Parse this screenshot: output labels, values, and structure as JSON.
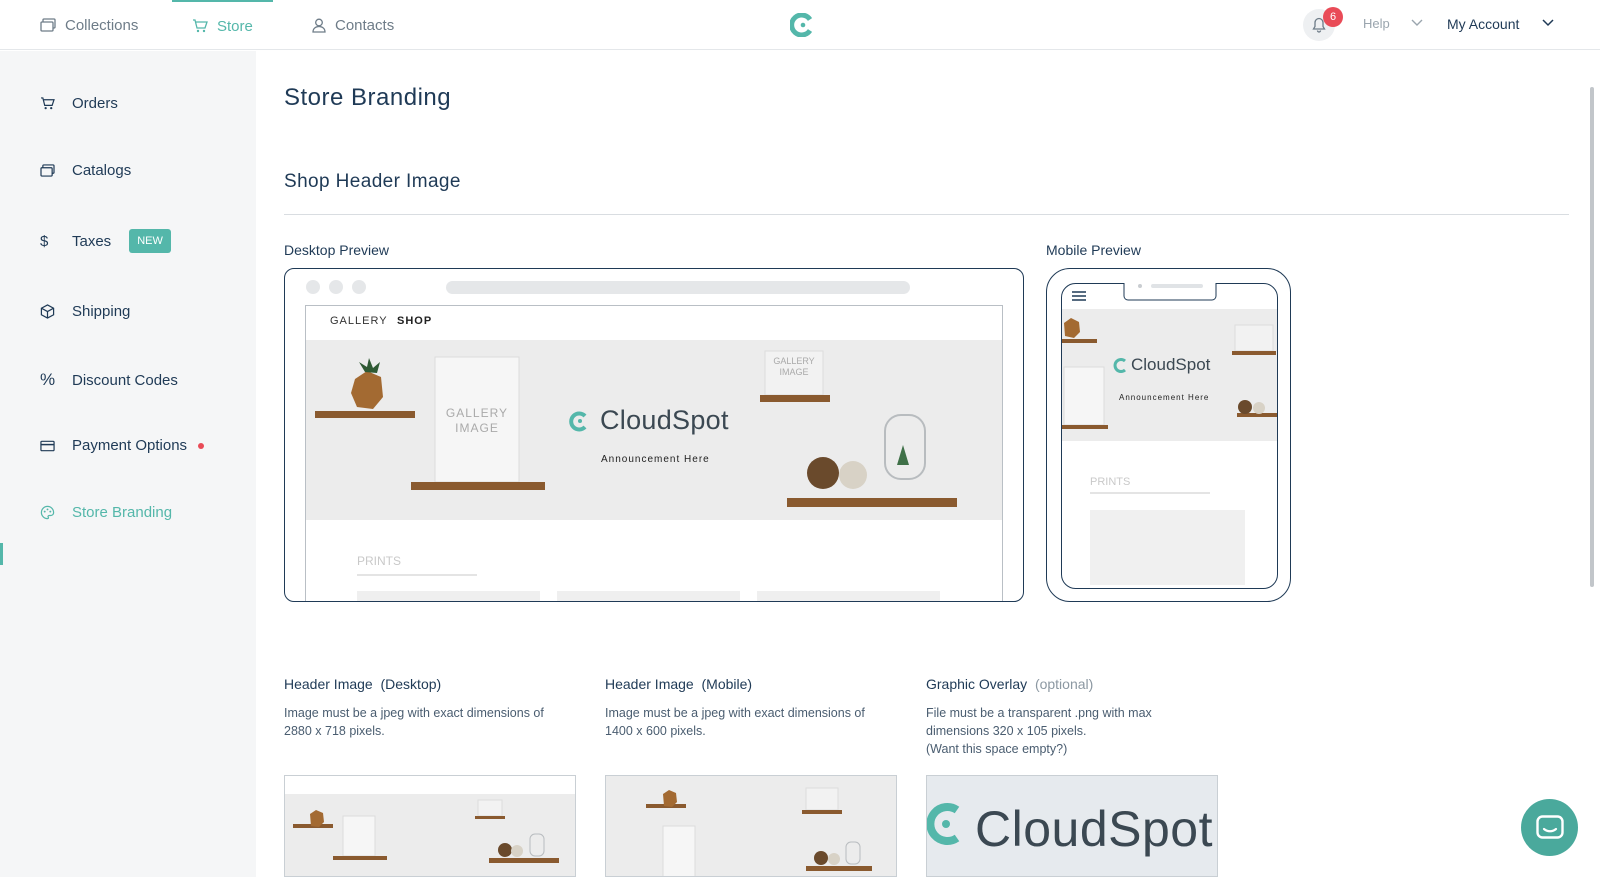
{
  "topnav": {
    "tabs": [
      {
        "label": "Collections",
        "icon": "collections-icon"
      },
      {
        "label": "Store",
        "icon": "cart-icon",
        "active": true
      },
      {
        "label": "Contacts",
        "icon": "person-icon"
      }
    ],
    "notifications_count": "6",
    "help_label": "Help",
    "account_label": "My Account"
  },
  "sidebar": {
    "items": [
      {
        "label": "Orders",
        "icon": "cart-icon"
      },
      {
        "label": "Catalogs",
        "icon": "catalog-icon"
      },
      {
        "label": "Taxes",
        "icon": "dollar-icon",
        "badge": "NEW"
      },
      {
        "label": "Shipping",
        "icon": "box-icon"
      },
      {
        "label": "Discount Codes",
        "icon": "percent-icon"
      },
      {
        "label": "Payment Options",
        "icon": "card-icon",
        "alert": true
      },
      {
        "label": "Store Branding",
        "icon": "palette-icon",
        "active": true
      }
    ]
  },
  "main": {
    "page_title": "Store Branding",
    "section_title": "Shop Header Image",
    "desktop_preview_label": "Desktop Preview",
    "mobile_preview_label": "Mobile Preview",
    "preview": {
      "nav_gallery": "GALLERY",
      "nav_shop": "SHOP",
      "gallery_image_text": "GALLERY\nIMAGE",
      "brand_name": "CloudSpot",
      "announcement": "Announcement Here",
      "prints_label": "PRINTS"
    },
    "uploads": [
      {
        "title": "Header Image",
        "qualifier": "(Desktop)",
        "desc1": "Image must be a jpeg with exact dimensions of",
        "desc2": "2880 x 718 pixels."
      },
      {
        "title": "Header Image",
        "qualifier": "(Mobile)",
        "desc1": "Image must be a jpeg with exact dimensions of",
        "desc2": "1400 x 600 pixels."
      },
      {
        "title": "Graphic Overlay",
        "qualifier": "(optional)",
        "desc1": "File must be a transparent .png with max",
        "desc2": "dimensions 320 x 105 pixels.",
        "desc3": "(Want this space empty?)"
      }
    ]
  },
  "colors": {
    "accent": "#54b7aa",
    "text": "#1f3a56",
    "alert": "#e94b57",
    "sidebar_bg": "#f5f6f7"
  }
}
